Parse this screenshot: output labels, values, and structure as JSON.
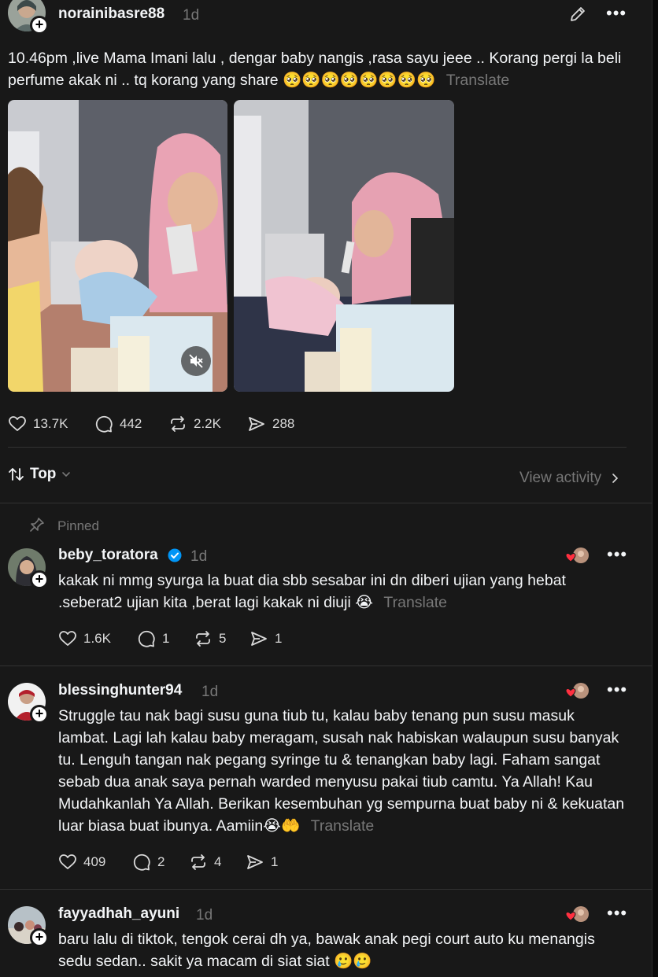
{
  "post": {
    "username": "norainibasre88",
    "time": "1d",
    "text": "10.46pm ,live Mama Imani lalu , dengar baby nangis ,rasa sayu jeee .. Korang pergi la beli perfume akak ni .. tq korang yang share 🥺🥺🥺🥺🥺🥺🥺🥺",
    "translate": "Translate",
    "likes": "13.7K",
    "replies": "442",
    "reposts": "2.2K",
    "shares": "288"
  },
  "sort": {
    "label": "Top",
    "view_activity": "View activity"
  },
  "pinned_label": "Pinned",
  "comments": [
    {
      "username": "beby_toratora",
      "time": "1d",
      "verified": true,
      "text": "kakak ni mmg syurga la buat dia sbb sesabar ini dn diberi ujian yang hebat .seberat2 ujian kita ,berat lagi kakak ni diuji 😭",
      "translate": "Translate",
      "likes": "1.6K",
      "replies": "1",
      "reposts": "5",
      "shares": "1"
    },
    {
      "username": "blessinghunter94",
      "time": "1d",
      "text": "Struggle tau nak bagi susu guna tiub tu, kalau baby tenang pun susu masuk lambat. Lagi lah kalau baby meragam, susah nak habiskan walaupun susu banyak tu. Lenguh tangan nak pegang syringe tu & tenangkan baby lagi. Faham sangat sebab dua anak saya pernah warded menyusu pakai tiub camtu. Ya Allah! Kau Mudahkanlah Ya Allah. Berikan kesembuhan yg sempurna buat baby ni & kekuatan luar biasa buat ibunya. Aamiin😭🤲",
      "translate": "Translate",
      "likes": "409",
      "replies": "2",
      "reposts": "4",
      "shares": "1"
    },
    {
      "username": "fayyadhah_ayuni",
      "time": "1d",
      "text": "baru lalu di tiktok, tengok cerai dh ya, bawak anak pegi court auto ku menangis sedu sedan.. sakit ya macam di siat siat 🥲🥲"
    }
  ],
  "colors": {
    "background": "#181818",
    "text": "#f3f5f7",
    "muted": "#777777",
    "verified": "#0095f6",
    "heart": "#ff3040"
  }
}
